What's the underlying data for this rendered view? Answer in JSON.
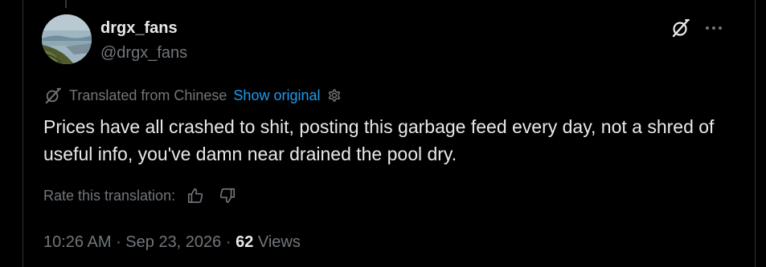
{
  "author": {
    "display_name": "drgx_fans",
    "handle": "@drgx_fans"
  },
  "icons": {
    "grok": "grok-icon",
    "more": "more-icon",
    "translate": "translate-icon",
    "settings": "settings-icon",
    "thumbs_up": "thumbs-up-icon",
    "thumbs_down": "thumbs-down-icon"
  },
  "translation": {
    "label": "Translated from Chinese",
    "show_original": "Show original"
  },
  "post": {
    "text": "Prices have all crashed to shit, posting this garbage feed every day, not a shred of useful info, you've damn near drained the pool dry."
  },
  "rate": {
    "label": "Rate this translation:"
  },
  "meta": {
    "time": "10:26 AM",
    "separator": " · ",
    "date": "Sep 23, 2026",
    "views_count": "62",
    "views_label": " Views"
  },
  "colors": {
    "background": "#000000",
    "primary_text": "#e7e9ea",
    "secondary_text": "#71767b",
    "link": "#1d9bf0",
    "border": "#2f3336"
  }
}
